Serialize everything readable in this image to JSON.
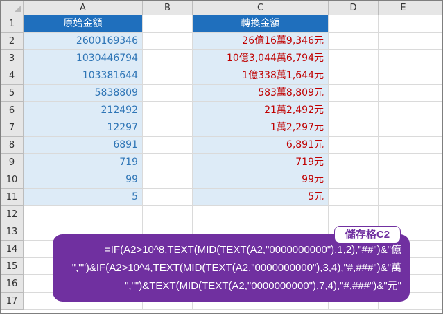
{
  "columns": [
    "A",
    "B",
    "C",
    "D",
    "E"
  ],
  "rows": [
    "1",
    "2",
    "3",
    "4",
    "5",
    "6",
    "7",
    "8",
    "9",
    "10",
    "11",
    "12",
    "13",
    "14",
    "15",
    "16",
    "17"
  ],
  "headers": {
    "a1": "原始金額",
    "c1": "轉換金額"
  },
  "source_values": [
    "2600169346",
    "1030446794",
    "103381644",
    "5838809",
    "212492",
    "12297",
    "6891",
    "719",
    "99",
    "5"
  ],
  "converted_values": [
    "26億16萬9,346元",
    "10億3,044萬6,794元",
    "1億338萬1,644元",
    "583萬8,809元",
    "21萬2,492元",
    "1萬2,297元",
    "6,891元",
    "719元",
    "99元",
    "5元"
  ],
  "callout": {
    "tag": "儲存格C2",
    "formula_lines": [
      "=IF(A2>10^8,TEXT(MID(TEXT(A2,\"0000000000\"),1,2),\"##\")&\"億",
      "\",\"\")&IF(A2>10^4,TEXT(MID(TEXT(A2,\"0000000000\"),3,4),\"#,###\")&\"萬",
      "\",\"\")&TEXT(MID(TEXT(A2,\"0000000000\"),7,4),\"#,###\")&\"元\""
    ]
  },
  "colors": {
    "header_fill": "#1f6fbd",
    "data_fill": "#ddebf7",
    "source_text": "#2e75b6",
    "converted_text": "#c00000",
    "callout_fill": "#7030a0"
  }
}
